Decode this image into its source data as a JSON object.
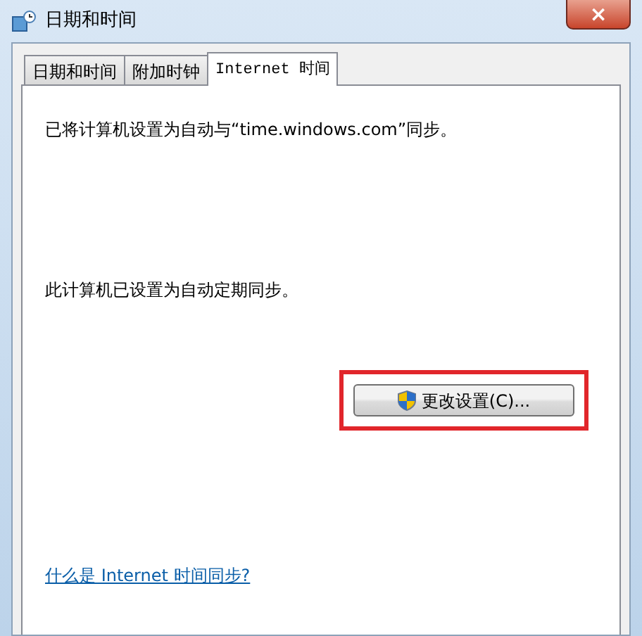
{
  "window": {
    "title": "日期和时间",
    "close": "×"
  },
  "tabs": [
    {
      "label": "日期和时间",
      "selected": false
    },
    {
      "label": "附加时钟",
      "selected": false
    },
    {
      "label": "Internet 时间",
      "selected": true
    }
  ],
  "panel": {
    "status": "已将计算机设置为自动与“time.windows.com”同步。",
    "sync_note": "此计算机已设置为自动定期同步。",
    "button": {
      "label": "更改设置(C)...",
      "highlighted": true
    },
    "link": "什么是 Internet 时间同步?"
  }
}
